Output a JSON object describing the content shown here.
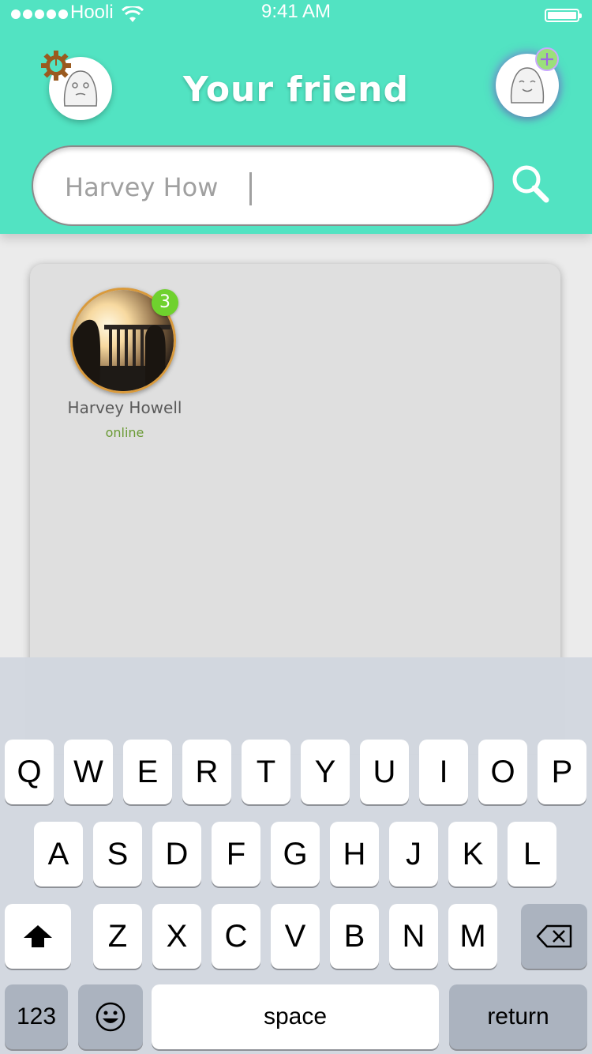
{
  "status_bar": {
    "carrier": "Hooli",
    "time": "9:41 AM"
  },
  "header": {
    "title": "Your friend",
    "icons": {
      "settings": "gear-icon",
      "add_friend": "plus-icon",
      "search": "search-icon"
    }
  },
  "search": {
    "value": "Harvey How"
  },
  "friends": [
    {
      "name": "Harvey Howell",
      "status": "online",
      "unread": "3"
    }
  ],
  "keyboard": {
    "row1": [
      "Q",
      "W",
      "E",
      "R",
      "T",
      "Y",
      "U",
      "I",
      "O",
      "P"
    ],
    "row2": [
      "A",
      "S",
      "D",
      "F",
      "G",
      "H",
      "J",
      "K",
      "L"
    ],
    "row3": [
      "Z",
      "X",
      "C",
      "V",
      "B",
      "N",
      "M"
    ],
    "numbers_label": "123",
    "space_label": "space",
    "return_label": "return"
  },
  "colors": {
    "header": "#52e3c2",
    "badge": "#6fd12e",
    "online": "#6a9a35"
  }
}
